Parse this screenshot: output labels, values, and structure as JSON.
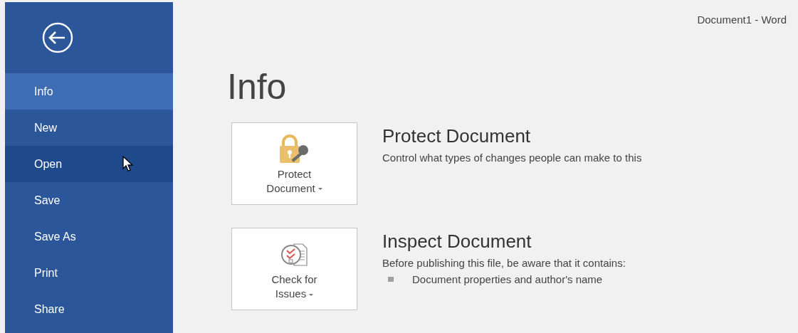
{
  "window": {
    "title": "Document1 - Word"
  },
  "sidebar": {
    "items": [
      {
        "label": "Info",
        "selected": true,
        "hovered": false
      },
      {
        "label": "New",
        "selected": false,
        "hovered": false
      },
      {
        "label": "Open",
        "selected": false,
        "hovered": true
      },
      {
        "label": "Save",
        "selected": false,
        "hovered": false
      },
      {
        "label": "Save As",
        "selected": false,
        "hovered": false
      },
      {
        "label": "Print",
        "selected": false,
        "hovered": false
      },
      {
        "label": "Share",
        "selected": false,
        "hovered": false
      }
    ]
  },
  "page_title": "Info",
  "sections": [
    {
      "kind": "protect",
      "button": [
        "Protect",
        "Document"
      ],
      "heading": "Protect Document",
      "description": "Control what types of changes people can make to this"
    },
    {
      "kind": "inspect",
      "button": [
        "Check for",
        "Issues"
      ],
      "heading": "Inspect Document",
      "description": "Before publishing this file, be aware that it contains:",
      "bullets": [
        "Document properties and author's name"
      ]
    }
  ]
}
